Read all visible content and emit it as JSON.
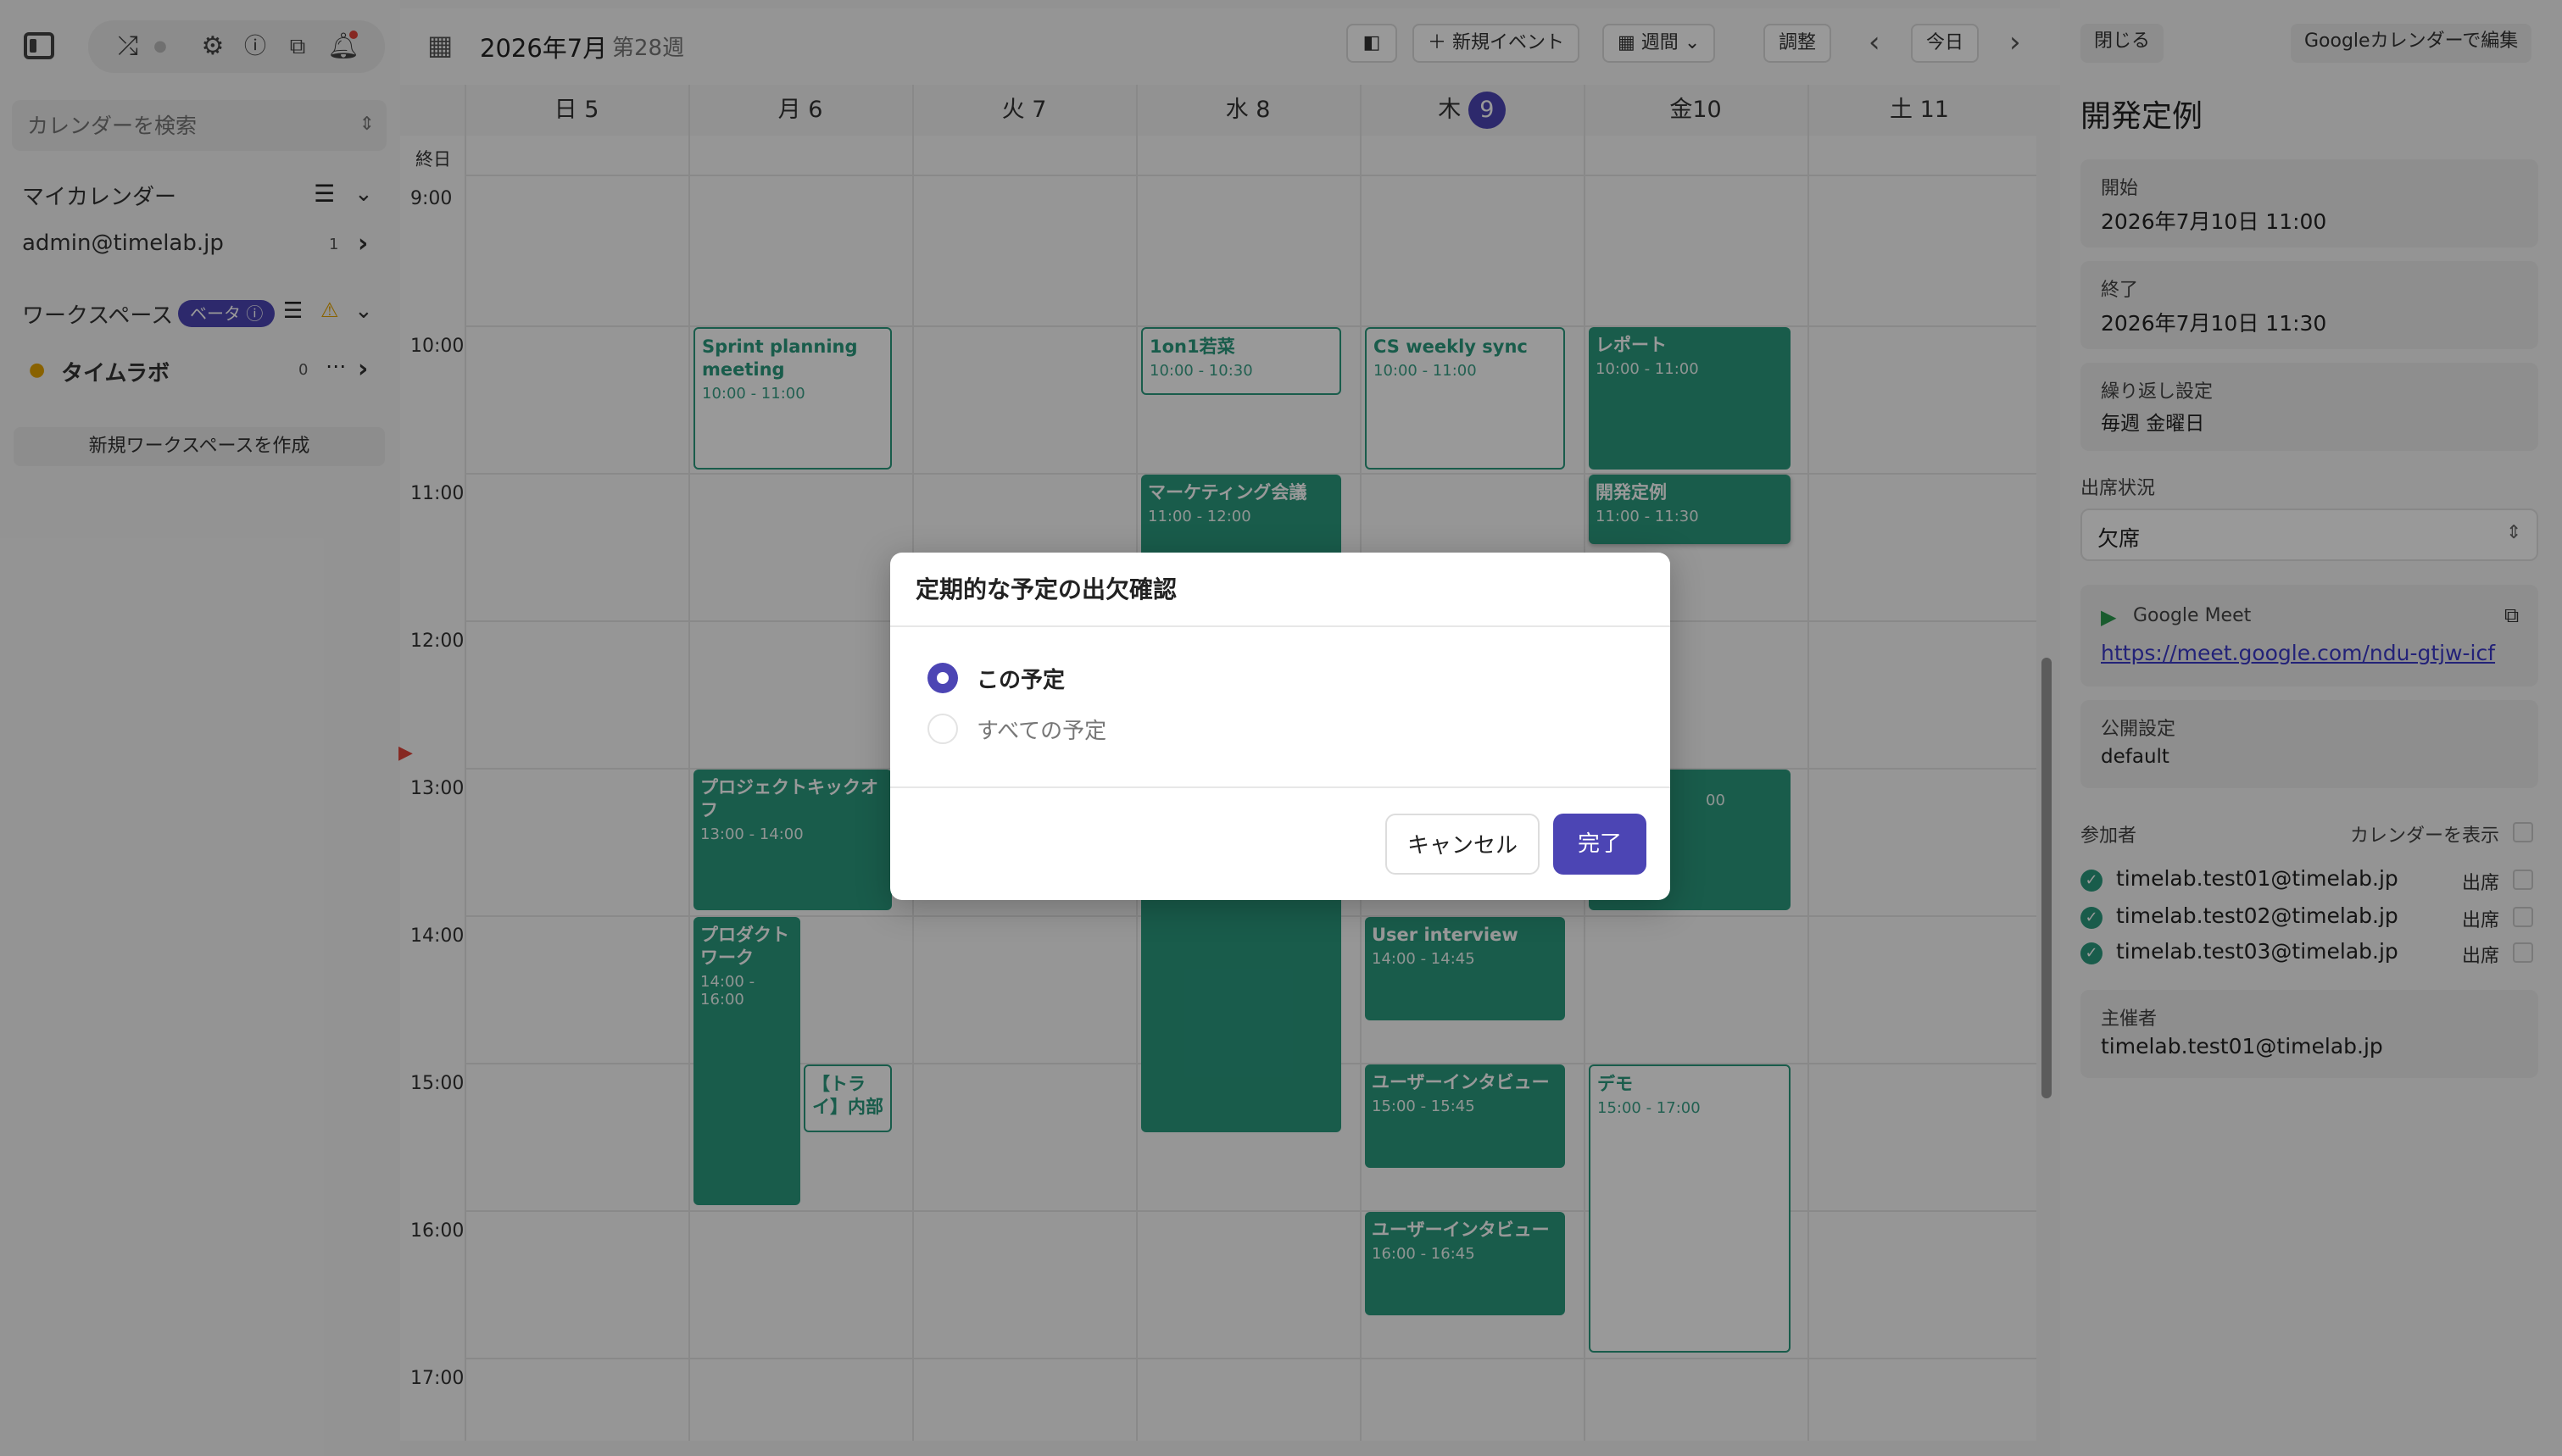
{
  "sidebar": {
    "search_placeholder": "カレンダーを検索",
    "my_calendar_label": "マイカレンダー",
    "my_calendar_item": "admin@timelab.jp",
    "my_calendar_count": "1",
    "workspace_label": "ワークスペース",
    "beta_badge": "ベータ",
    "workspace_item": "タイムラボ",
    "workspace_count": "0",
    "new_workspace": "新規ワークスペースを作成"
  },
  "calendar": {
    "month": "2026年7月",
    "week": "第28週",
    "new_event": "新規イベント",
    "view_select": "週間",
    "adjust": "調整",
    "today": "今日",
    "all_day": "終日",
    "days": [
      {
        "name": "日",
        "num": "5"
      },
      {
        "name": "月",
        "num": "6"
      },
      {
        "name": "火",
        "num": "7"
      },
      {
        "name": "水",
        "num": "8"
      },
      {
        "name": "木",
        "num": "9"
      },
      {
        "name": "金",
        "num": "10"
      },
      {
        "name": "土",
        "num": "11"
      }
    ],
    "hours": [
      "9:00",
      "10:00",
      "11:00",
      "12:00",
      "13:00",
      "14:00",
      "15:00",
      "16:00",
      "17:00"
    ],
    "events": [
      {
        "title": "Sprint planning meeting",
        "time": "10:00 - 11:00"
      },
      {
        "title": "1on1若菜",
        "time": "10:00 - 10:30"
      },
      {
        "title": "CS weekly sync",
        "time": "10:00 - 11:00"
      },
      {
        "title": "レポート",
        "time": "10:00 - 11:00"
      },
      {
        "title": "マーケティング会議",
        "time": "11:00 - 12:00"
      },
      {
        "title": "開発定例",
        "time": "11:00 - 11:30"
      },
      {
        "title": "プロジェクトキックオフ",
        "time": "13:00 - 14:00"
      },
      {
        "title": "",
        "time": "00"
      },
      {
        "title": "プロダクトワーク",
        "time": "14:00 - 16:00"
      },
      {
        "title": "User interview",
        "time": "14:00 - 14:45"
      },
      {
        "title": "【トライ】内部",
        "time": ""
      },
      {
        "title": "ユーザーインタビュー",
        "time": "15:00 - 15:45"
      },
      {
        "title": "デモ",
        "time": "15:00 - 17:00"
      },
      {
        "title": "ユーザーインタビュー",
        "time": "16:00 - 16:45"
      }
    ]
  },
  "detail": {
    "close": "閉じる",
    "edit_google": "Googleカレンダーで編集",
    "title": "開発定例",
    "start_label": "開始",
    "start_value": "2026年7月10日 11:00",
    "end_label": "終了",
    "end_value": "2026年7月10日 11:30",
    "repeat_label": "繰り返し設定",
    "repeat_value": "毎週 金曜日",
    "attendance_label": "出席状況",
    "attendance_value": "欠席",
    "meet_label": "Google Meet",
    "meet_link": "https://meet.google.com/ndu-gtjw-icf",
    "visibility_label": "公開設定",
    "visibility_value": "default",
    "participants_label": "参加者",
    "show_calendar": "カレンダーを表示",
    "participants": [
      {
        "email": "timelab.test01@timelab.jp",
        "status": "出席"
      },
      {
        "email": "timelab.test02@timelab.jp",
        "status": "出席"
      },
      {
        "email": "timelab.test03@timelab.jp",
        "status": "出席"
      }
    ],
    "organizer_label": "主催者",
    "organizer_value": "timelab.test01@timelab.jp"
  },
  "modal": {
    "title": "定期的な予定の出欠確認",
    "option_this": "この予定",
    "option_all": "すべての予定",
    "cancel": "キャンセル",
    "done": "完了"
  },
  "colors": {
    "accent": "#4c45b4",
    "event_green": "#2a9a7e",
    "current_time": "#e0443a"
  }
}
